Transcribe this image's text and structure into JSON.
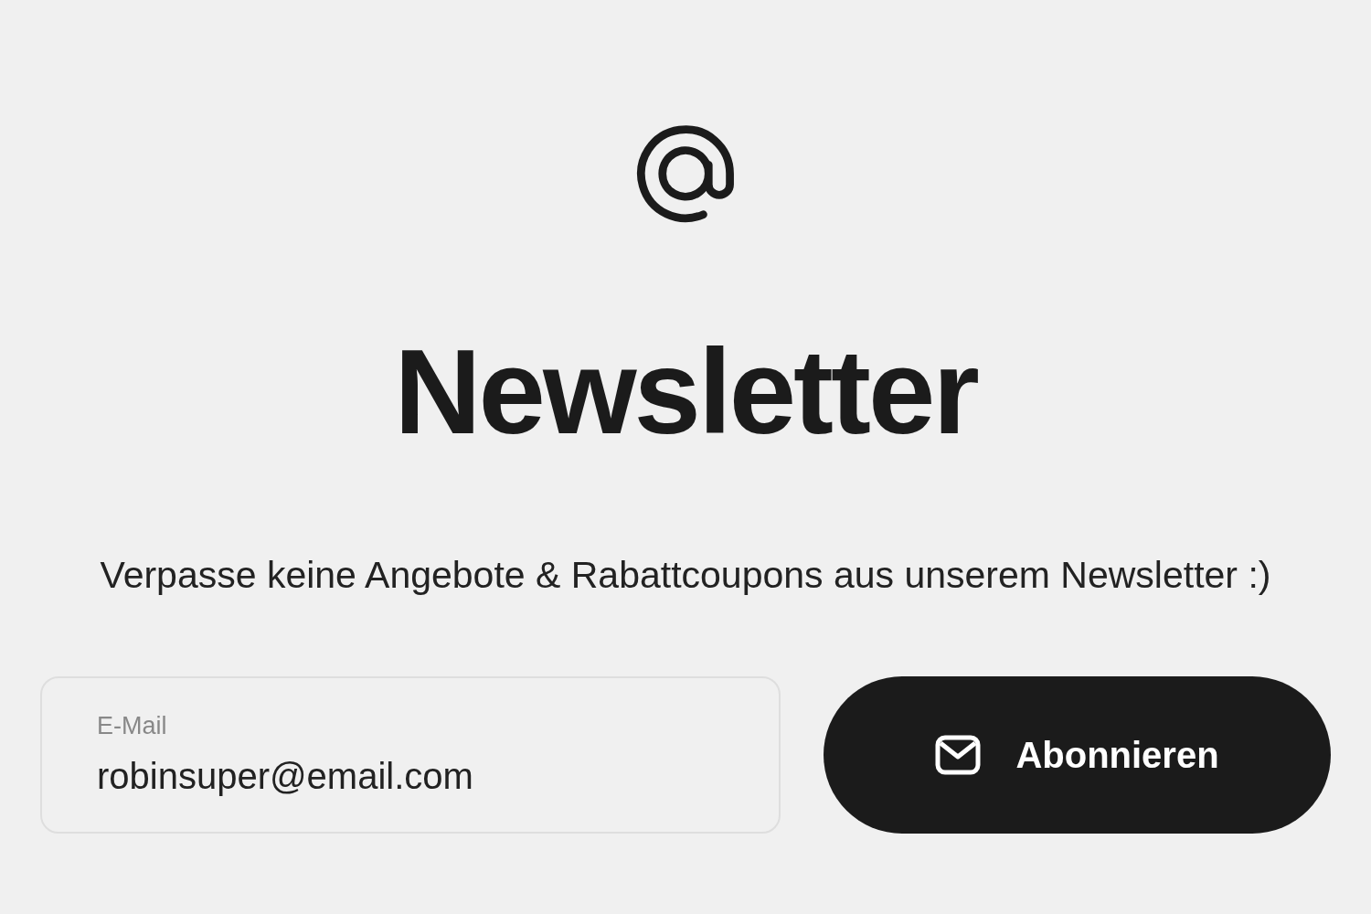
{
  "title": "Newsletter",
  "subtitle": "Verpasse keine Angebote & Rabattcoupons aus unserem Newsletter :)",
  "email_field": {
    "label": "E-Mail",
    "value": "robinsuper@email.com"
  },
  "subscribe_button": {
    "label": "Abonnieren"
  }
}
